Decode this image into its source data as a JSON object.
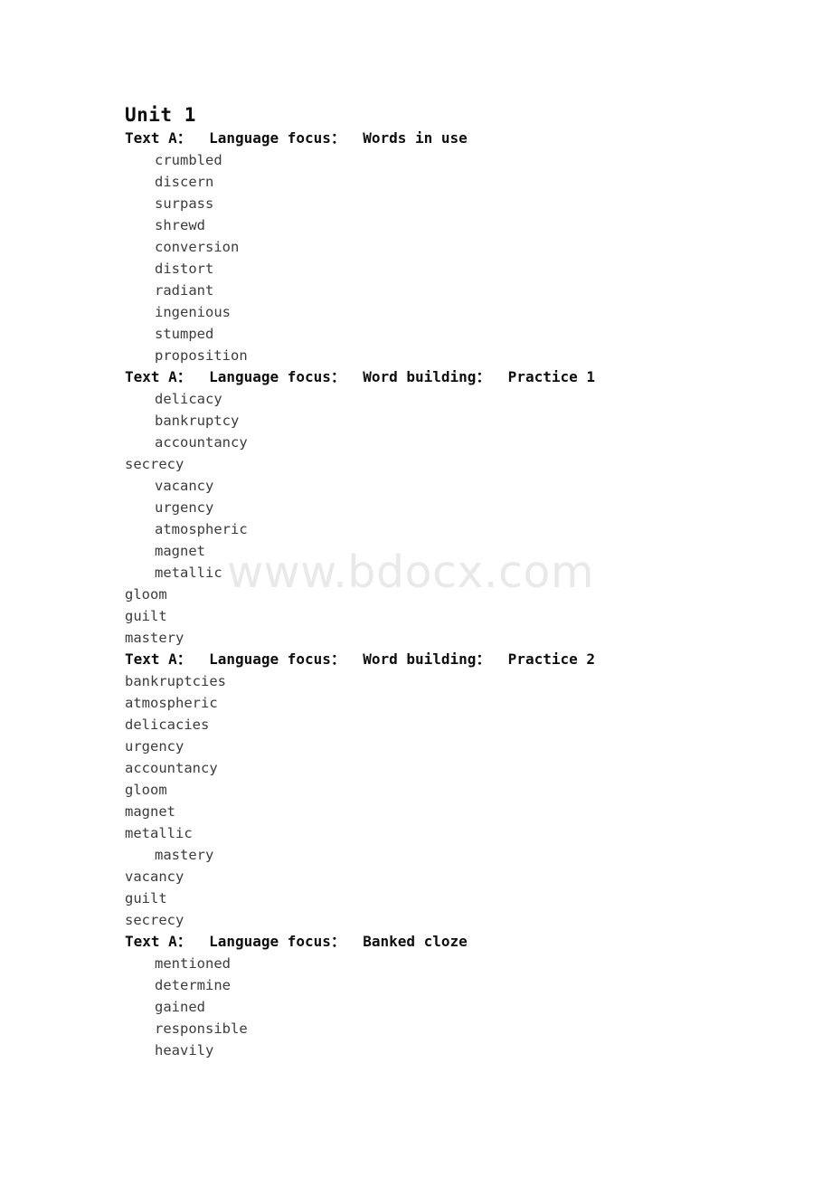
{
  "document": {
    "title": "Unit 1",
    "watermark": "www.bdocx.com"
  },
  "sections": [
    {
      "heading": "Text A：  Language focus：  Words in use",
      "answers": [
        {
          "text": "crumbled",
          "indent": true
        },
        {
          "text": "discern",
          "indent": true
        },
        {
          "text": "surpass",
          "indent": true
        },
        {
          "text": "shrewd",
          "indent": true
        },
        {
          "text": "conversion",
          "indent": true
        },
        {
          "text": "distort",
          "indent": true
        },
        {
          "text": "radiant",
          "indent": true
        },
        {
          "text": "ingenious",
          "indent": true
        },
        {
          "text": "stumped",
          "indent": true
        },
        {
          "text": "proposition",
          "indent": true
        }
      ]
    },
    {
      "heading": "Text A：  Language focus：  Word building：  Practice 1",
      "answers": [
        {
          "text": "delicacy",
          "indent": true
        },
        {
          "text": "bankruptcy",
          "indent": true
        },
        {
          "text": "accountancy",
          "indent": true
        },
        {
          "text": "secrecy",
          "indent": false
        },
        {
          "text": "vacancy",
          "indent": true
        },
        {
          "text": "urgency",
          "indent": true
        },
        {
          "text": "atmospheric",
          "indent": true
        },
        {
          "text": "magnet",
          "indent": true
        },
        {
          "text": "metallic",
          "indent": true
        },
        {
          "text": "gloom",
          "indent": false
        },
        {
          "text": "guilt",
          "indent": false
        },
        {
          "text": "mastery",
          "indent": false
        }
      ]
    },
    {
      "heading": "Text A：  Language focus：  Word building：  Practice 2",
      "answers": [
        {
          "text": "bankruptcies",
          "indent": false
        },
        {
          "text": "atmospheric",
          "indent": false
        },
        {
          "text": "delicacies",
          "indent": false
        },
        {
          "text": "urgency",
          "indent": false
        },
        {
          "text": "accountancy",
          "indent": false
        },
        {
          "text": "gloom",
          "indent": false
        },
        {
          "text": "magnet",
          "indent": false
        },
        {
          "text": "metallic",
          "indent": false
        },
        {
          "text": "mastery",
          "indent": true
        },
        {
          "text": "vacancy",
          "indent": false
        },
        {
          "text": "guilt",
          "indent": false
        },
        {
          "text": "secrecy",
          "indent": false
        }
      ]
    },
    {
      "heading": "Text A：  Language focus：  Banked cloze",
      "answers": [
        {
          "text": "mentioned",
          "indent": true
        },
        {
          "text": "determine",
          "indent": true
        },
        {
          "text": "gained",
          "indent": true
        },
        {
          "text": "responsible",
          "indent": true
        },
        {
          "text": "heavily",
          "indent": true
        }
      ]
    }
  ]
}
